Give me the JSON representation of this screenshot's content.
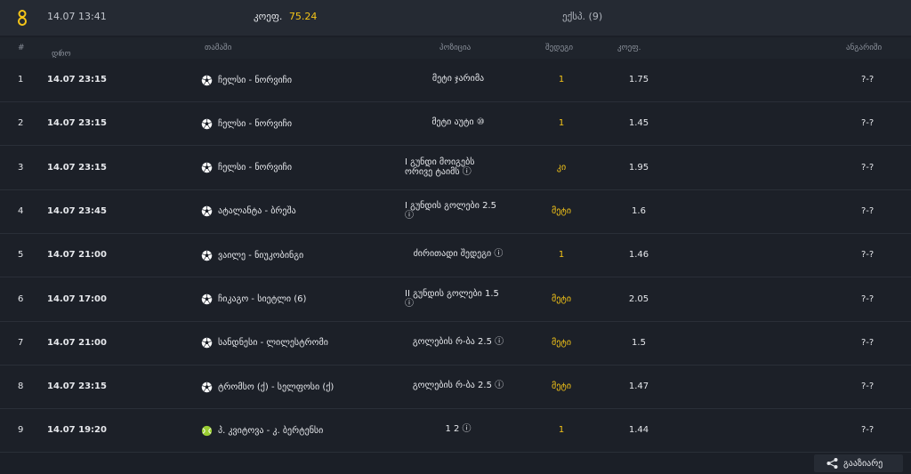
{
  "header": {
    "date": "14.07 13:41",
    "odds_label": "კოეფ.",
    "odds_value": "75.24",
    "express_label": "ექსპ. (9)",
    "accent_color": "#f5c518"
  },
  "table": {
    "headers": {
      "num": "#",
      "date": "დრო",
      "game": "თამაში",
      "position": "პოზიცია",
      "bet": "შედეგი",
      "odds": "კოეფ.",
      "result": "ანგარიში"
    },
    "rows": [
      {
        "num": "1",
        "date": "14.07 23:15",
        "sport_icon": "soccer-ball-icon",
        "game": "ჩელსი - ნორვიჩი",
        "position": "მეტი ჯარიმა",
        "bet": "1",
        "odds": "1.75",
        "result": "?-?"
      },
      {
        "num": "2",
        "date": "14.07 23:15",
        "sport_icon": "soccer-ball-icon",
        "game": "ჩელსი - ნორვიჩი",
        "position": "მეტი აუტი ⑩",
        "bet": "1",
        "odds": "1.45",
        "result": "?-?"
      },
      {
        "num": "3",
        "date": "14.07 23:15",
        "sport_icon": "soccer-ball-icon",
        "game": "ჩელსი - ნორვიჩი",
        "position": "I გუნდი მოიგებს\nორივე ტაიმს ⓘ",
        "bet": "კი",
        "odds": "1.95",
        "result": "?-?"
      },
      {
        "num": "4",
        "date": "14.07 23:45",
        "sport_icon": "soccer-ball-icon",
        "game": "ატალანტა - ბრეშა",
        "position": "I გუნდის გოლები 2.5\nⓘ",
        "bet": "მეტი",
        "odds": "1.6",
        "result": "?-?"
      },
      {
        "num": "5",
        "date": "14.07 21:00",
        "sport_icon": "soccer-ball-icon",
        "game": "ვაილე - ნიუკობინგი",
        "position": "ძირითადი შედეგი ⓘ",
        "bet": "1",
        "odds": "1.46",
        "result": "?-?"
      },
      {
        "num": "6",
        "date": "14.07 17:00",
        "sport_icon": "soccer-ball-icon",
        "game": "ჩიკაგო - სიეტლი (6)",
        "position": "II გუნდის გოლები 1.5\nⓘ",
        "bet": "მეტი",
        "odds": "2.05",
        "result": "?-?"
      },
      {
        "num": "7",
        "date": "14.07 21:00",
        "sport_icon": "soccer-ball-icon",
        "game": "სანდნესი - ლილესტრომი",
        "position": "გოლების რ-ბა 2.5 ⓘ",
        "bet": "მეტი",
        "odds": "1.5",
        "result": "?-?"
      },
      {
        "num": "8",
        "date": "14.07 23:15",
        "sport_icon": "soccer-ball-icon",
        "game": "ტრომსო (ქ) - სელფოსი (ქ)",
        "position": "გოლების რ-ბა 2.5 ⓘ",
        "bet": "მეტი",
        "odds": "1.47",
        "result": "?-?"
      },
      {
        "num": "9",
        "date": "14.07 19:20",
        "sport_icon": "tennis-ball-icon",
        "game": "პ. კვიტოვა - კ. ბერტენსი",
        "position": "1 2 ⓘ",
        "bet": "1",
        "odds": "1.44",
        "result": "?-?"
      }
    ]
  },
  "share": {
    "label": "გააზიარე",
    "icon": "share-icon"
  }
}
